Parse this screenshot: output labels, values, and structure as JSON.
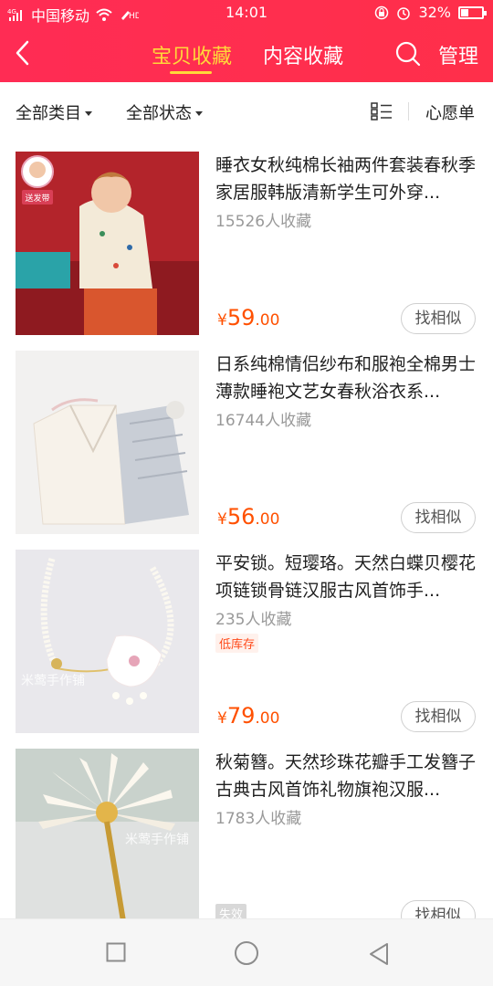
{
  "status_bar": {
    "carrier": "中国移动",
    "network": "4G",
    "time": "14:01",
    "battery": "32%"
  },
  "header": {
    "tabs": [
      {
        "label": "宝贝收藏",
        "active": true
      },
      {
        "label": "内容收藏",
        "active": false
      }
    ],
    "manage_label": "管理"
  },
  "filters": {
    "category": "全部类目",
    "status": "全部状态",
    "wishlist": "心愿单"
  },
  "items": [
    {
      "title": "睡衣女秋纯棉长袖两件套装春秋季家居服韩版清新学生可外穿...",
      "favorites": "15526人收藏",
      "badge_on_image": "送发带",
      "tag": "",
      "price_symbol": "¥",
      "price_int": "59",
      "price_dec": ".00",
      "similar_label": "找相似"
    },
    {
      "title": "日系纯棉情侣纱布和服袍全棉男士薄款睡袍文艺女春秋浴衣系...",
      "favorites": "16744人收藏",
      "tag": "",
      "price_symbol": "¥",
      "price_int": "56",
      "price_dec": ".00",
      "similar_label": "找相似"
    },
    {
      "title": "平安锁。短璎珞。天然白蝶贝樱花项链锁骨链汉服古风首饰手...",
      "favorites": "235人收藏",
      "tag": "低库存",
      "watermark": "米莺手作铺",
      "price_symbol": "¥",
      "price_int": "79",
      "price_dec": ".00",
      "similar_label": "找相似"
    },
    {
      "title": "秋菊簪。天然珍珠花瓣手工发簪子古典古风首饰礼物旗袍汉服...",
      "favorites": "1783人收藏",
      "tag": "失效",
      "watermark": "米莺手作铺",
      "similar_label": "找相似"
    }
  ],
  "colors": {
    "brand": "#ff2c54",
    "active_tab": "#ffd93a",
    "price": "#ff5000"
  },
  "icons": [
    "signal-icon",
    "wifi-icon",
    "hd-icon",
    "lock-rotation-icon",
    "alarm-icon",
    "battery-icon",
    "back-icon",
    "search-icon",
    "list-view-icon",
    "square-nav-icon",
    "circle-nav-icon",
    "triangle-nav-icon"
  ]
}
